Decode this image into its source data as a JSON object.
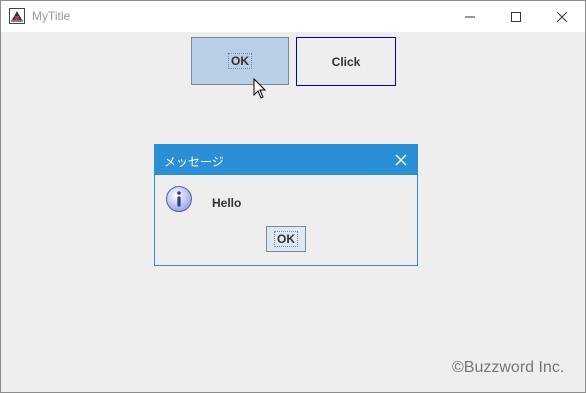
{
  "window": {
    "title": "MyTitle",
    "controls": [
      "minimize-icon",
      "maximize-icon",
      "close-icon"
    ]
  },
  "main": {
    "ok_button_label": "OK",
    "click_button_label": "Click"
  },
  "dialog": {
    "title": "メッセージ",
    "message": "Hello",
    "ok_label": "OK",
    "icon": "info-icon",
    "accent_color": "#2b8fd6"
  },
  "watermark": "©Buzzword Inc.",
  "colors": {
    "ok_button_bg": "#b8cfe5",
    "click_button_border": "#0000cc",
    "window_bg": "#eeeeee"
  }
}
